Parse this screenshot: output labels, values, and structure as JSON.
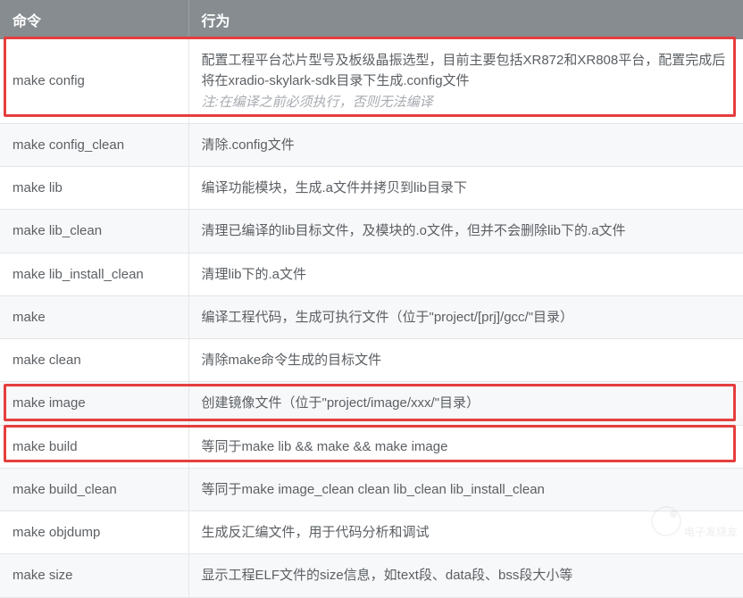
{
  "header": {
    "command": "命令",
    "behavior": "行为"
  },
  "rows": [
    {
      "cmd": "make config",
      "desc": "配置工程平台芯片型号及板级晶振选型，目前主要包括XR872和XR808平台，配置完成后将在xradio-skylark-sdk目录下生成.config文件",
      "note": "注:在编译之前必须执行，否则无法编译"
    },
    {
      "cmd": "make config_clean",
      "desc": "清除.config文件"
    },
    {
      "cmd": "make lib",
      "desc": "编译功能模块，生成.a文件并拷贝到lib目录下"
    },
    {
      "cmd": "make lib_clean",
      "desc": "清理已编译的lib目标文件，及模块的.o文件，但并不会删除lib下的.a文件"
    },
    {
      "cmd": "make lib_install_clean",
      "desc": "清理lib下的.a文件"
    },
    {
      "cmd": "make",
      "desc": "编译工程代码，生成可执行文件（位于\"project/[prj]/gcc/\"目录）"
    },
    {
      "cmd": "make clean",
      "desc": "清除make命令生成的目标文件"
    },
    {
      "cmd": "make image",
      "desc": "创建镜像文件（位于\"project/image/xxx/\"目录）"
    },
    {
      "cmd": "make build",
      "desc": "等同于make lib && make && make image"
    },
    {
      "cmd": "make build_clean",
      "desc": "等同于make image_clean clean lib_clean lib_install_clean"
    },
    {
      "cmd": "make objdump",
      "desc": "生成反汇编文件，用于代码分析和调试"
    },
    {
      "cmd": "make size",
      "desc": "显示工程ELF文件的size信息，如text段、data段、bss段大小等"
    }
  ],
  "highlights": [
    0,
    8,
    9
  ],
  "watermark": "电子发烧友"
}
